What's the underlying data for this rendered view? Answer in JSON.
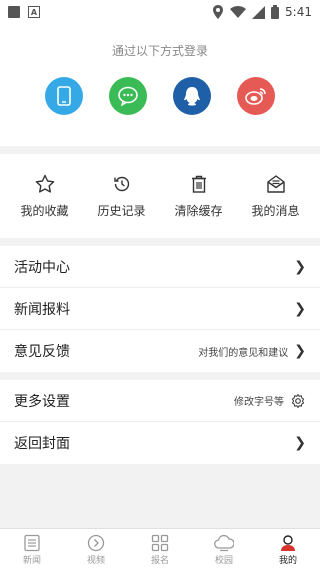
{
  "status_bar": {
    "time": "5:41",
    "a_badge": "A"
  },
  "login": {
    "title": "通过以下方式登录",
    "methods": [
      {
        "name": "phone-icon",
        "color": "#35a9e6"
      },
      {
        "name": "wechat-icon",
        "color": "#3bbb55"
      },
      {
        "name": "qq-icon",
        "color": "#1e5fa8"
      },
      {
        "name": "weibo-icon",
        "color": "#e65a55"
      }
    ]
  },
  "quick": {
    "items": [
      {
        "label": "我的收藏",
        "icon": "star-icon"
      },
      {
        "label": "历史记录",
        "icon": "history-icon"
      },
      {
        "label": "清除缓存",
        "icon": "trash-icon"
      },
      {
        "label": "我的消息",
        "icon": "message-icon"
      }
    ]
  },
  "menu1": {
    "items": [
      {
        "label": "活动中心",
        "hint": ""
      },
      {
        "label": "新闻报料",
        "hint": ""
      },
      {
        "label": "意见反馈",
        "hint": "对我们的意见和建议"
      }
    ]
  },
  "menu2": {
    "items": [
      {
        "label": "更多设置",
        "hint": "修改字号等"
      },
      {
        "label": "返回封面",
        "hint": ""
      }
    ]
  },
  "bottom_nav": {
    "items": [
      {
        "label": "新闻",
        "icon": "news-icon"
      },
      {
        "label": "视频",
        "icon": "video-icon"
      },
      {
        "label": "报名",
        "icon": "grid-icon"
      },
      {
        "label": "校园",
        "icon": "cloud-icon"
      },
      {
        "label": "我的",
        "icon": "profile-icon",
        "active": true
      }
    ]
  }
}
